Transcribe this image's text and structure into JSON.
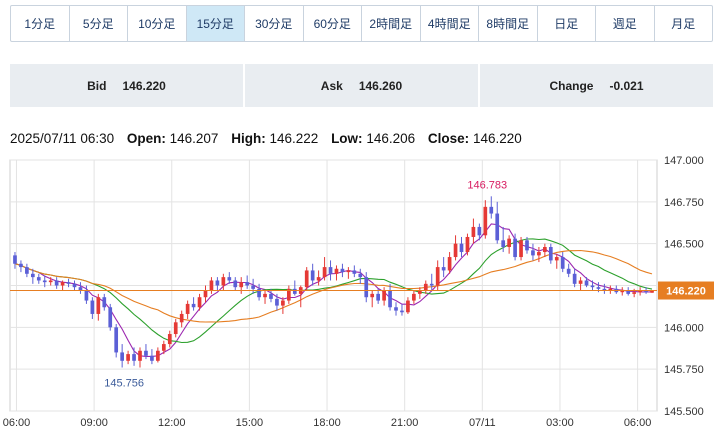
{
  "timeframes": {
    "items": [
      {
        "label": "1分足"
      },
      {
        "label": "5分足"
      },
      {
        "label": "10分足"
      },
      {
        "label": "15分足"
      },
      {
        "label": "30分足"
      },
      {
        "label": "60分足"
      },
      {
        "label": "2時間足"
      },
      {
        "label": "4時間足"
      },
      {
        "label": "8時間足"
      },
      {
        "label": "日足"
      },
      {
        "label": "週足"
      },
      {
        "label": "月足"
      }
    ],
    "active": "15分足"
  },
  "quote": {
    "bid_label": "Bid",
    "bid_value": "146.220",
    "ask_label": "Ask",
    "ask_value": "146.260",
    "change_label": "Change",
    "change_value": "-0.021"
  },
  "ohlc": {
    "datetime": "2025/07/11 06:30",
    "open_label": "Open:",
    "open": "146.207",
    "high_label": "High:",
    "high": "146.222",
    "low_label": "Low:",
    "low": "146.206",
    "close_label": "Close:",
    "close": "146.220"
  },
  "colors": {
    "up": "#e53935",
    "down": "#5b5fd6",
    "ma_short": "#9c27b0",
    "ma_mid": "#2ca02c",
    "ma_long": "#e67e22",
    "current": "#e67e22",
    "high_label": "#d81b60",
    "low_label": "#3b5b9a"
  },
  "chart_data": {
    "type": "candlestick",
    "ylim": [
      145.5,
      147.0
    ],
    "yticks": [
      "145.500",
      "145.750",
      "146.000",
      "146.250",
      "146.500",
      "146.750",
      "147.000"
    ],
    "xticks": [
      "06:00",
      "09:00",
      "12:00",
      "15:00",
      "18:00",
      "21:00",
      "07/11",
      "03:00",
      "06:00"
    ],
    "current_price": "146.220",
    "high_label": "146.783",
    "low_label": "145.756",
    "candles": [
      [
        146.43,
        146.45,
        146.35,
        146.38
      ],
      [
        146.38,
        146.4,
        146.33,
        146.36
      ],
      [
        146.36,
        146.38,
        146.3,
        146.32
      ],
      [
        146.32,
        146.35,
        146.26,
        146.3
      ],
      [
        146.3,
        146.32,
        146.26,
        146.28
      ],
      [
        146.28,
        146.31,
        146.24,
        146.27
      ],
      [
        146.27,
        146.3,
        146.25,
        146.28
      ],
      [
        146.28,
        146.3,
        146.23,
        146.25
      ],
      [
        146.25,
        146.28,
        146.22,
        146.27
      ],
      [
        146.27,
        146.29,
        146.24,
        146.26
      ],
      [
        146.26,
        146.28,
        146.22,
        146.24
      ],
      [
        146.24,
        146.27,
        146.2,
        146.22
      ],
      [
        146.22,
        146.25,
        146.14,
        146.16
      ],
      [
        146.16,
        146.18,
        146.05,
        146.08
      ],
      [
        146.08,
        146.2,
        146.04,
        146.18
      ],
      [
        146.18,
        146.2,
        146.1,
        146.12
      ],
      [
        146.12,
        146.14,
        145.98,
        146.0
      ],
      [
        146.0,
        146.02,
        145.82,
        145.85
      ],
      [
        145.85,
        145.9,
        145.76,
        145.8
      ],
      [
        145.8,
        145.86,
        145.78,
        145.84
      ],
      [
        145.84,
        145.88,
        145.77,
        145.8
      ],
      [
        145.8,
        145.88,
        145.76,
        145.86
      ],
      [
        145.86,
        145.9,
        145.81,
        145.83
      ],
      [
        145.83,
        145.87,
        145.78,
        145.8
      ],
      [
        145.8,
        145.88,
        145.79,
        145.86
      ],
      [
        145.86,
        145.92,
        145.84,
        145.9
      ],
      [
        145.9,
        145.98,
        145.88,
        145.96
      ],
      [
        145.96,
        146.05,
        145.94,
        146.03
      ],
      [
        146.03,
        146.1,
        146.0,
        146.08
      ],
      [
        146.08,
        146.16,
        146.05,
        146.14
      ],
      [
        146.14,
        146.18,
        146.1,
        146.12
      ],
      [
        146.12,
        146.2,
        146.1,
        146.18
      ],
      [
        146.18,
        146.25,
        146.15,
        146.22
      ],
      [
        146.22,
        146.3,
        146.2,
        146.28
      ],
      [
        146.28,
        146.3,
        146.22,
        146.25
      ],
      [
        146.25,
        146.32,
        146.22,
        146.3
      ],
      [
        146.3,
        146.33,
        146.26,
        146.28
      ],
      [
        146.28,
        146.3,
        146.22,
        146.24
      ],
      [
        146.24,
        146.3,
        146.2,
        146.27
      ],
      [
        146.27,
        146.31,
        146.23,
        146.25
      ],
      [
        146.25,
        146.29,
        146.2,
        146.23
      ],
      [
        146.23,
        146.26,
        146.16,
        146.18
      ],
      [
        146.18,
        146.22,
        146.14,
        146.2
      ],
      [
        146.2,
        146.23,
        146.15,
        146.17
      ],
      [
        146.17,
        146.2,
        146.1,
        146.13
      ],
      [
        146.13,
        146.18,
        146.08,
        146.16
      ],
      [
        146.16,
        146.25,
        146.14,
        146.23
      ],
      [
        146.23,
        146.28,
        146.19,
        146.2
      ],
      [
        146.2,
        146.25,
        146.12,
        146.24
      ],
      [
        146.24,
        146.36,
        146.22,
        146.34
      ],
      [
        146.34,
        146.38,
        146.25,
        146.28
      ],
      [
        146.28,
        146.34,
        146.25,
        146.3
      ],
      [
        146.3,
        146.42,
        146.28,
        146.36
      ],
      [
        146.36,
        146.4,
        146.28,
        146.32
      ],
      [
        146.32,
        146.37,
        146.28,
        146.35
      ],
      [
        146.35,
        146.38,
        146.3,
        146.33
      ],
      [
        146.33,
        146.36,
        146.29,
        146.34
      ],
      [
        146.34,
        146.37,
        146.3,
        146.32
      ],
      [
        146.32,
        146.35,
        146.26,
        146.3
      ],
      [
        146.3,
        146.33,
        146.15,
        146.18
      ],
      [
        146.18,
        146.22,
        146.12,
        146.2
      ],
      [
        146.2,
        146.23,
        146.14,
        146.16
      ],
      [
        146.16,
        146.24,
        146.13,
        146.22
      ],
      [
        146.22,
        146.26,
        146.1,
        146.12
      ],
      [
        146.12,
        146.15,
        146.07,
        146.1
      ],
      [
        146.1,
        146.14,
        146.07,
        146.09
      ],
      [
        146.09,
        146.18,
        146.08,
        146.16
      ],
      [
        146.16,
        146.22,
        146.14,
        146.2
      ],
      [
        146.2,
        146.24,
        146.17,
        146.22
      ],
      [
        146.22,
        146.28,
        146.2,
        146.26
      ],
      [
        146.26,
        146.32,
        146.22,
        146.25
      ],
      [
        146.25,
        146.4,
        146.22,
        146.36
      ],
      [
        146.36,
        146.42,
        146.3,
        146.34
      ],
      [
        146.34,
        146.45,
        146.32,
        146.42
      ],
      [
        146.42,
        146.55,
        146.4,
        146.5
      ],
      [
        146.5,
        146.54,
        146.42,
        146.45
      ],
      [
        146.45,
        146.56,
        146.43,
        146.54
      ],
      [
        146.54,
        146.65,
        146.5,
        146.6
      ],
      [
        146.6,
        146.62,
        146.52,
        146.55
      ],
      [
        146.55,
        146.76,
        146.53,
        146.72
      ],
      [
        146.72,
        146.783,
        146.65,
        146.68
      ],
      [
        146.68,
        146.75,
        146.5,
        146.52
      ],
      [
        146.52,
        146.6,
        146.45,
        146.48
      ],
      [
        146.48,
        146.55,
        146.44,
        146.53
      ],
      [
        146.53,
        146.56,
        146.4,
        146.42
      ],
      [
        146.42,
        146.54,
        146.4,
        146.52
      ],
      [
        146.52,
        146.54,
        146.44,
        146.46
      ],
      [
        146.46,
        146.5,
        146.4,
        146.43
      ],
      [
        146.43,
        146.48,
        146.39,
        146.45
      ],
      [
        146.45,
        146.5,
        146.42,
        146.48
      ],
      [
        146.48,
        146.5,
        146.38,
        146.4
      ],
      [
        146.4,
        146.44,
        146.35,
        146.42
      ],
      [
        146.42,
        146.45,
        146.33,
        146.35
      ],
      [
        146.35,
        146.38,
        146.3,
        146.32
      ],
      [
        146.32,
        146.35,
        146.24,
        146.26
      ],
      [
        146.26,
        146.3,
        146.22,
        146.28
      ],
      [
        146.28,
        146.3,
        146.24,
        146.25
      ],
      [
        146.25,
        146.28,
        146.22,
        146.24
      ],
      [
        146.24,
        146.27,
        146.21,
        146.23
      ],
      [
        146.23,
        146.26,
        146.2,
        146.22
      ],
      [
        146.22,
        146.25,
        146.2,
        146.23
      ],
      [
        146.23,
        146.25,
        146.2,
        146.21
      ],
      [
        146.21,
        146.24,
        146.19,
        146.22
      ],
      [
        146.22,
        146.24,
        146.19,
        146.2
      ],
      [
        146.2,
        146.23,
        146.18,
        146.21
      ],
      [
        146.21,
        146.24,
        146.19,
        146.22
      ],
      [
        146.22,
        146.24,
        146.2,
        146.21
      ],
      [
        146.207,
        146.222,
        146.206,
        146.22
      ]
    ]
  }
}
